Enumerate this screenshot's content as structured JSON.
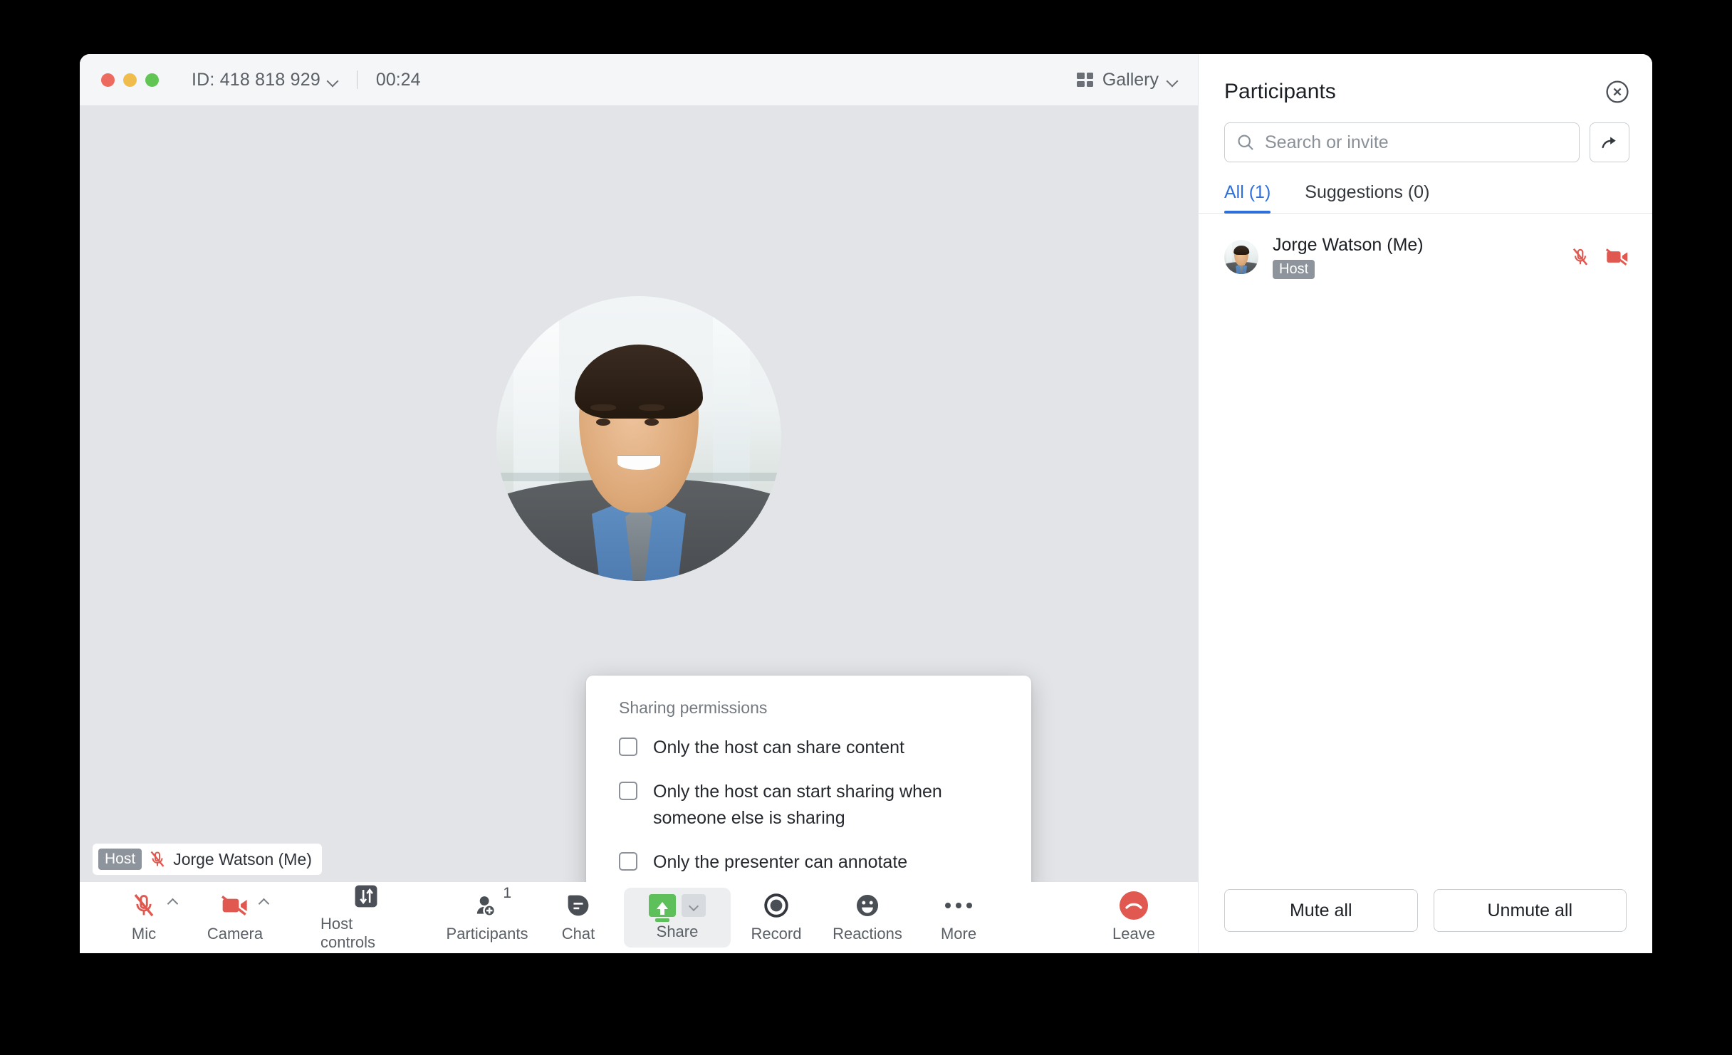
{
  "titlebar": {
    "meeting_id": "ID: 418 818 929",
    "timer": "00:24",
    "view_mode": "Gallery",
    "chevron_icon": "chevron-down-icon",
    "grid_icon": "grid-icon"
  },
  "stage": {
    "name_overlay": {
      "badge": "Host",
      "name": "Jorge Watson (Me)",
      "mic_icon": "mic-muted-icon"
    }
  },
  "popover": {
    "title": "Sharing permissions",
    "options": [
      {
        "label": "Only the host can share content",
        "checked": false
      },
      {
        "label": "Only the host can start sharing when someone else is sharing",
        "checked": false
      },
      {
        "label": "Only the presenter can annotate",
        "checked": false
      }
    ]
  },
  "toolbar": {
    "items": [
      {
        "label": "Mic",
        "icon": "mic-muted-icon",
        "has_caret": true,
        "active": false
      },
      {
        "label": "Camera",
        "icon": "camera-off-icon",
        "has_caret": true,
        "active": false
      },
      {
        "label": "Host controls",
        "icon": "sliders-icon",
        "has_caret": false,
        "active": false
      },
      {
        "label": "Participants",
        "icon": "person-add-icon",
        "badge": "1",
        "has_caret": false,
        "active": false
      },
      {
        "label": "Chat",
        "icon": "chat-bubble-icon",
        "has_caret": false,
        "active": false
      },
      {
        "label": "Share",
        "icon": "share-screen-icon",
        "has_caret": true,
        "active": true
      },
      {
        "label": "Record",
        "icon": "record-circle-icon",
        "has_caret": false,
        "active": false
      },
      {
        "label": "Reactions",
        "icon": "smiley-icon",
        "has_caret": false,
        "active": false
      },
      {
        "label": "More",
        "icon": "ellipsis-icon",
        "has_caret": false,
        "active": false
      },
      {
        "label": "Leave",
        "icon": "hangup-icon",
        "has_caret": false,
        "active": false
      }
    ]
  },
  "panel": {
    "title": "Participants",
    "close_icon": "close-circle-icon",
    "search": {
      "placeholder": "Search or invite",
      "search_icon": "search-icon",
      "invite_icon": "share-arrow-icon"
    },
    "tabs": [
      {
        "label": "All (1)",
        "active": true
      },
      {
        "label": "Suggestions (0)",
        "active": false
      }
    ],
    "participants": [
      {
        "name": "Jorge Watson (Me)",
        "badge": "Host",
        "mic_icon": "mic-muted-icon",
        "camera_icon": "camera-off-icon"
      }
    ],
    "footer": {
      "mute_all": "Mute all",
      "unmute_all": "Unmute all"
    }
  },
  "colors": {
    "accent_blue": "#2f6fdb",
    "danger_red": "#e0584f",
    "share_green": "#5ec05a",
    "badge_gray": "#8d949c"
  }
}
